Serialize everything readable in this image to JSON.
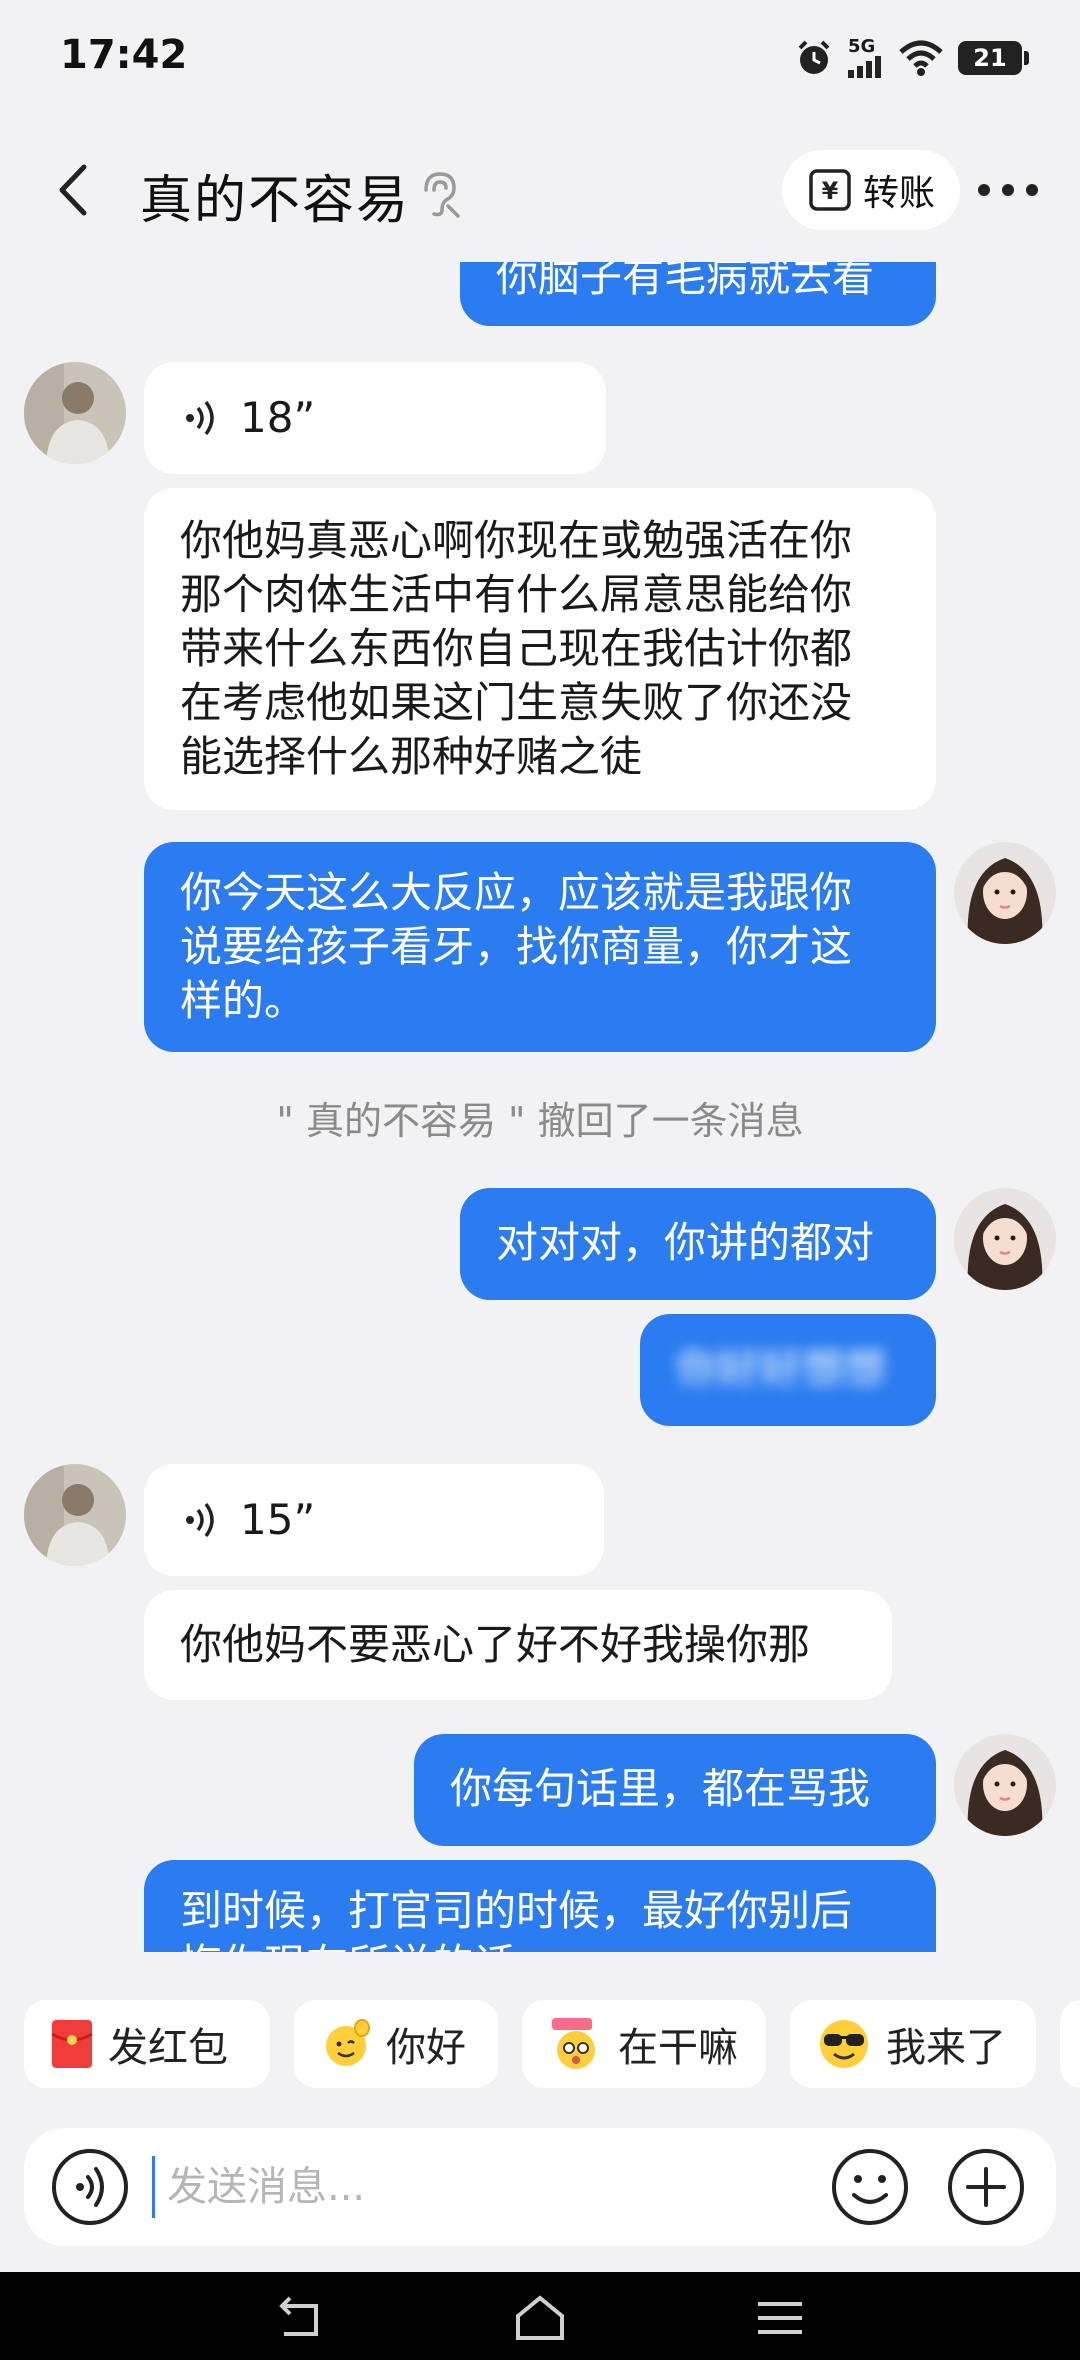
{
  "status_bar": {
    "time": "17:42",
    "network": "5G",
    "battery": "21",
    "icons": [
      "alarm-icon",
      "signal-icon",
      "wifi-icon",
      "battery-icon"
    ]
  },
  "header": {
    "title": "真的不容易",
    "transfer_label": "转账",
    "icons": [
      "back-icon",
      "ear-icon",
      "transfer-icon",
      "more-icon"
    ]
  },
  "chat": {
    "messages": [
      {
        "side": "out",
        "type": "text",
        "text": "你脑子有毛病就去看"
      },
      {
        "side": "in",
        "type": "voice",
        "duration": "18”"
      },
      {
        "side": "in",
        "type": "text",
        "lines": [
          "你他妈真恶心啊你现在或勉强活在你",
          "那个肉体生活中有什么屌意思能给你",
          "带来什么东西你自己现在我估计你都",
          "在考虑他如果这门生意失败了你还没",
          "能选择什么那种好赌之徒"
        ]
      },
      {
        "side": "out",
        "type": "text",
        "lines": [
          "你今天这么大反应，应该就是我跟你",
          "说要给孩子看牙，找你商量，你才这",
          "样的。"
        ]
      },
      {
        "type": "system",
        "text": "\" 真的不容易 \" 撤回了一条消息"
      },
      {
        "side": "out",
        "type": "text",
        "text": "对对对，你讲的都对"
      },
      {
        "side": "out",
        "type": "blurred",
        "text": "你好好想想"
      },
      {
        "side": "in",
        "type": "voice",
        "duration": "15”"
      },
      {
        "side": "in",
        "type": "text",
        "text": "你他妈不要恶心了好不好我操你那"
      },
      {
        "side": "out",
        "type": "text",
        "text": "你每句话里，都在骂我"
      },
      {
        "side": "out",
        "type": "text",
        "lines": [
          "到时候，打官司的时候，最好你别后",
          "悔你现在所说的话"
        ]
      }
    ]
  },
  "quick_replies": [
    {
      "label": "发红包",
      "icon": "red-envelope-icon"
    },
    {
      "label": "你好",
      "icon": "wave-emoji-icon"
    },
    {
      "label": "在干嘛",
      "icon": "curious-emoji-icon"
    },
    {
      "label": "我来了",
      "icon": "sunglasses-emoji-icon"
    }
  ],
  "input": {
    "placeholder": "发送消息..."
  },
  "colors": {
    "outgoing_bubble": "#2a7cf0",
    "incoming_bubble": "#ffffff",
    "background": "#f2f2f4"
  }
}
